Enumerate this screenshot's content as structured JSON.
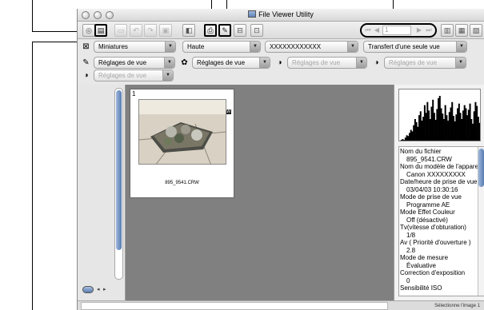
{
  "window": {
    "title": "File Viewer Utility"
  },
  "toolbar": {
    "buttons": [
      {
        "name": "browse-folder-button",
        "glyph": "◎",
        "state": "normal"
      },
      {
        "name": "thumbnail-view-button",
        "glyph": "▤",
        "state": "active"
      },
      {
        "name": "copy-image-button",
        "glyph": "▭",
        "state": "dim"
      },
      {
        "name": "rotate-left-button",
        "glyph": "↶",
        "state": "dim"
      },
      {
        "name": "rotate-right-button",
        "glyph": "↷",
        "state": "dim"
      },
      {
        "name": "slideshow-button",
        "glyph": "▣",
        "state": "dim"
      },
      {
        "name": "open-in-editor-button",
        "glyph": "◧",
        "state": "normal"
      },
      {
        "name": "print-button",
        "glyph": "⎙",
        "state": "active"
      },
      {
        "name": "transfer-button",
        "glyph": "✎",
        "state": "active"
      },
      {
        "name": "tag-button",
        "glyph": "⊟",
        "state": "normal"
      },
      {
        "name": "delete-button",
        "glyph": "⊡",
        "state": "normal"
      },
      {
        "name": "layout-single-button",
        "glyph": "▥",
        "state": "normal"
      },
      {
        "name": "layout-grid-button",
        "glyph": "▦",
        "state": "normal"
      },
      {
        "name": "layout-detail-button",
        "glyph": "▧",
        "state": "normal"
      },
      {
        "name": "info-button",
        "glyph": "●",
        "state": "normal"
      }
    ],
    "nav": {
      "first": "⏮",
      "prev": "◀",
      "page": "1",
      "next": "▶",
      "last": "⏭"
    }
  },
  "selectors": {
    "view_mode": "Miniatures",
    "quality": "Haute",
    "name_field": "XXXXXXXXXXXX",
    "transfer_mode": "Transfert d'une seule vue"
  },
  "view_settings": [
    "Réglages de vue",
    "Réglages de vue",
    "Réglages de vue",
    "Réglages de vue",
    "Réglages de vue"
  ],
  "thumbnail": {
    "number": "1",
    "filename": "895_9541.CRW",
    "badge": "RAW"
  },
  "histogram": {
    "values": [
      2,
      3,
      4,
      3,
      6,
      9,
      8,
      12,
      16,
      14,
      22,
      30,
      26,
      20,
      35,
      40,
      28,
      33,
      48,
      38,
      52,
      41,
      30,
      46,
      55,
      38,
      29,
      43,
      57,
      60,
      44,
      37,
      30,
      48,
      35,
      28,
      39,
      45,
      52,
      34,
      27,
      36,
      44,
      50,
      38,
      30,
      41,
      48,
      44,
      35,
      42,
      50,
      30,
      24,
      40,
      52,
      47,
      33,
      25,
      20
    ]
  },
  "info": [
    {
      "text": "Nom du fichier",
      "kind": "label"
    },
    {
      "text": "895_9541.CRW",
      "kind": "value"
    },
    {
      "text": "Nom du modèle de l'appareil",
      "kind": "label"
    },
    {
      "text": "Canon XXXXXXXXX",
      "kind": "value"
    },
    {
      "text": "Date/heure de prise de vue",
      "kind": "label"
    },
    {
      "text": "03/04/03 10:30:16",
      "kind": "value"
    },
    {
      "text": "Mode de prise de vue",
      "kind": "label"
    },
    {
      "text": "Programme AE",
      "kind": "value"
    },
    {
      "text": "Mode Effet Couleur",
      "kind": "label"
    },
    {
      "text": "Off (désactivé)",
      "kind": "value"
    },
    {
      "text": "Tv(vitesse d'obturation)",
      "kind": "label"
    },
    {
      "text": "1/8",
      "kind": "value"
    },
    {
      "text": "Av ( Priorité d'ouverture )",
      "kind": "label"
    },
    {
      "text": "2.8",
      "kind": "value"
    },
    {
      "text": "Mode de mesure",
      "kind": "label"
    },
    {
      "text": "Évaluative",
      "kind": "value"
    },
    {
      "text": "Correction d'exposition",
      "kind": "label"
    },
    {
      "text": "0",
      "kind": "value"
    },
    {
      "text": "Sensibilité ISO",
      "kind": "label"
    }
  ],
  "status": {
    "selection": "Sélectionne l'image 1"
  }
}
